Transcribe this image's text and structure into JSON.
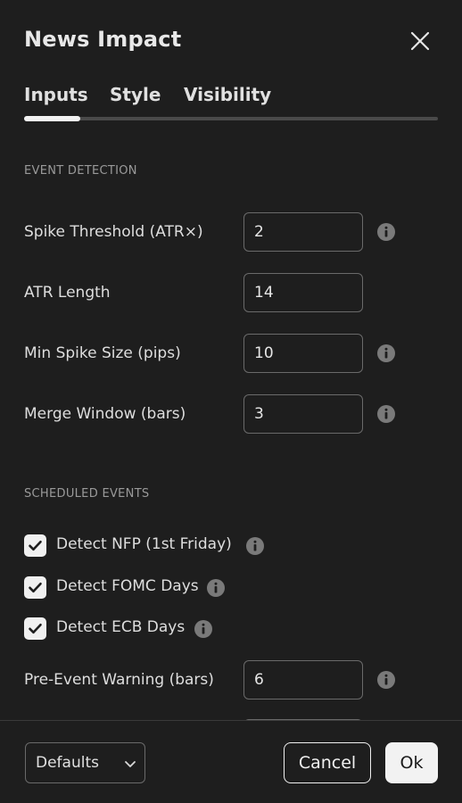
{
  "dialog": {
    "title": "News Impact"
  },
  "tabs": [
    {
      "label": "Inputs",
      "active": true
    },
    {
      "label": "Style",
      "active": false
    },
    {
      "label": "Visibility",
      "active": false
    }
  ],
  "sections": {
    "event_detection": {
      "title": "EVENT DETECTION",
      "rows": [
        {
          "label": "Spike Threshold (ATR×)",
          "value": "2",
          "has_info": true
        },
        {
          "label": "ATR Length",
          "value": "14",
          "has_info": false
        },
        {
          "label": "Min Spike Size (pips)",
          "value": "10",
          "has_info": true
        },
        {
          "label": "Merge Window (bars)",
          "value": "3",
          "has_info": true
        }
      ]
    },
    "scheduled_events": {
      "title": "SCHEDULED EVENTS",
      "checkboxes": [
        {
          "label": "Detect NFP (1st Friday)",
          "checked": true
        },
        {
          "label": "Detect FOMC Days",
          "checked": true
        },
        {
          "label": "Detect ECB Days",
          "checked": true
        }
      ],
      "rows": [
        {
          "label": "Pre-Event Warning (bars)",
          "value": "6",
          "has_info": true
        }
      ]
    }
  },
  "footer": {
    "defaults_label": "Defaults",
    "cancel_label": "Cancel",
    "ok_label": "Ok"
  },
  "colors": {
    "background": "#1e1e1e",
    "text": "#dedede",
    "section_text": "#9a9a9a",
    "input_border": "#6a6a6a",
    "checkbox_fill": "#f0f0f0",
    "ok_button": "#f2f2f2"
  },
  "icons": {
    "close": "close-icon",
    "info": "info-icon",
    "check": "check-icon",
    "chevron": "chevron-down-icon"
  }
}
